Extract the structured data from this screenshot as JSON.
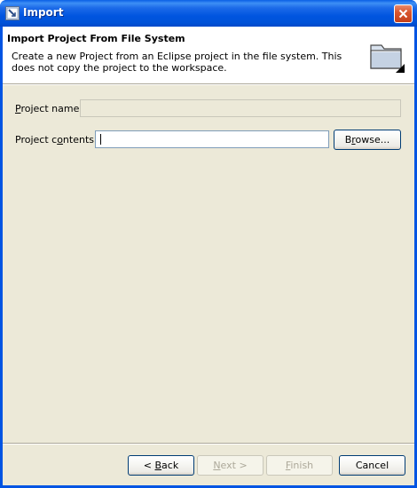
{
  "window": {
    "title": "Import",
    "colors": {
      "titlebar": "#0054e3",
      "dialog_background": "#ece9d8",
      "close_button": "#d9572f"
    }
  },
  "header": {
    "title": "Import Project From File System",
    "description": "Create a new Project from an Eclipse project in the file system. This does not copy the project to the workspace.",
    "image_icon": "folder-icon"
  },
  "form": {
    "project_name": {
      "label_mnemonic": "P",
      "label_rest": "roject name:",
      "value": "",
      "enabled": false
    },
    "project_contents": {
      "label_pre": "Project c",
      "label_mnemonic": "o",
      "label_post": "ntents:",
      "value": "",
      "enabled": true
    },
    "browse_pre": "B",
    "browse_mnemonic": "r",
    "browse_post": "owse..."
  },
  "footer": {
    "back_prefix": "< ",
    "back_mnemonic": "B",
    "back_rest": "ack",
    "next_mnemonic": "N",
    "next_rest": "ext >",
    "finish_mnemonic": "F",
    "finish_rest": "inish",
    "cancel_label": "Cancel"
  }
}
